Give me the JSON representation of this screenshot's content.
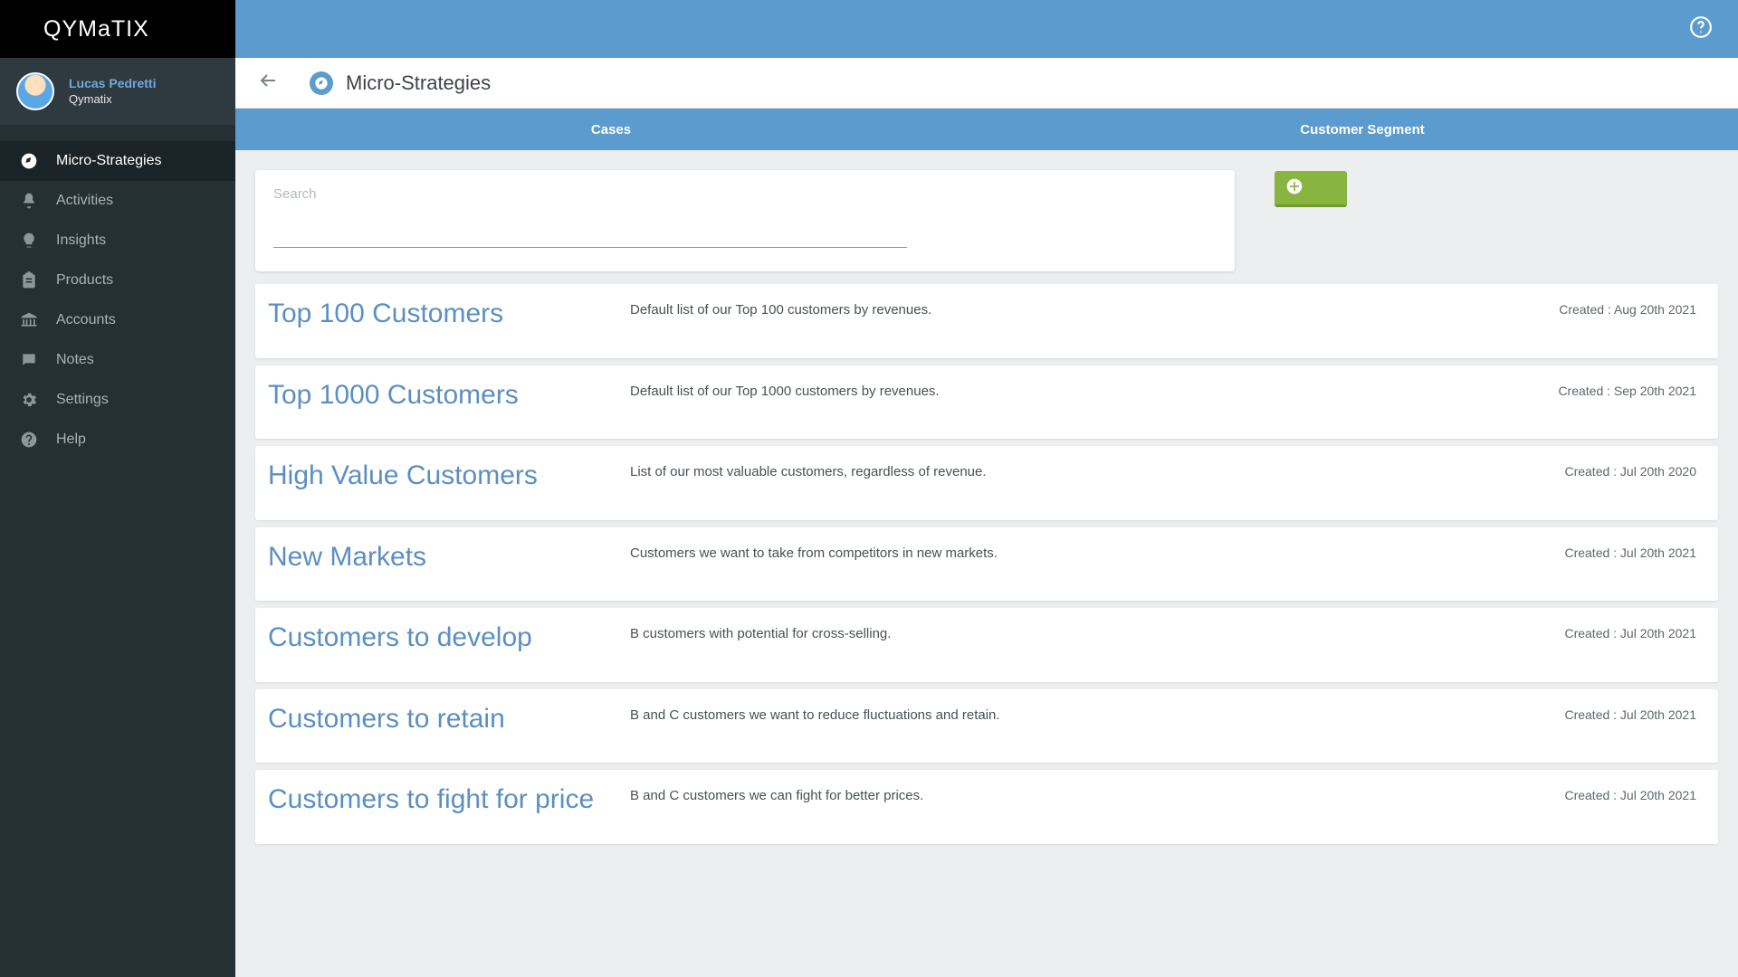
{
  "brand": "QYMaTIX",
  "user": {
    "name": "Lucas Pedretti",
    "company": "Qymatix"
  },
  "sidebar": {
    "items": [
      {
        "label": "Micro-Strategies"
      },
      {
        "label": "Activities"
      },
      {
        "label": "Insights"
      },
      {
        "label": "Products"
      },
      {
        "label": "Accounts"
      },
      {
        "label": "Notes"
      },
      {
        "label": "Settings"
      },
      {
        "label": "Help"
      }
    ]
  },
  "page": {
    "title": "Micro-Strategies"
  },
  "tabs": {
    "cases": "Cases",
    "segment": "Customer Segment"
  },
  "search": {
    "label": "Search",
    "value": ""
  },
  "created_prefix": "Created : ",
  "strategies": [
    {
      "title": "Top 100 Customers",
      "desc": "Default list of our Top 100 customers by revenues.",
      "created": "Aug 20th 2021"
    },
    {
      "title": "Top 1000 Customers",
      "desc": "Default list of our Top 1000 customers by revenues.",
      "created": "Sep 20th 2021"
    },
    {
      "title": "High Value Customers",
      "desc": "List of our most valuable customers, regardless of revenue.",
      "created": "Jul 20th 2020"
    },
    {
      "title": "New Markets",
      "desc": "Customers we want to take from competitors in new markets.",
      "created": "Jul 20th 2021"
    },
    {
      "title": "Customers to develop",
      "desc": "B customers with potential for cross-selling.",
      "created": "Jul 20th 2021"
    },
    {
      "title": "Customers to retain",
      "desc": "B and C customers we want to reduce fluctuations and retain.",
      "created": "Jul 20th 2021"
    },
    {
      "title": "Customers to fight for price",
      "desc": "B and C customers we can fight for better prices.",
      "created": "Jul 20th 2021"
    }
  ]
}
